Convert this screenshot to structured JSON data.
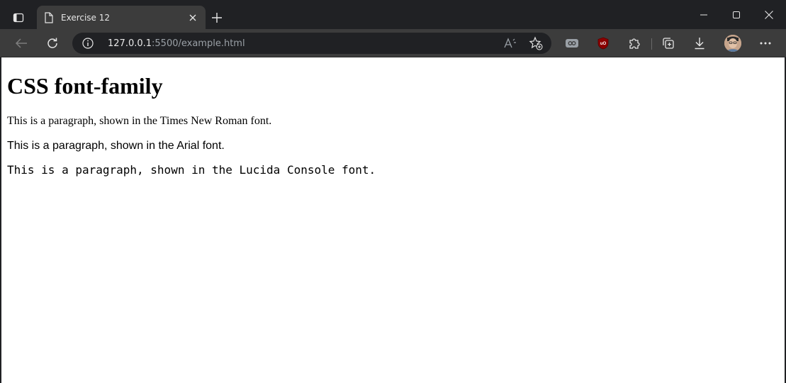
{
  "tab": {
    "title": "Exercise 12",
    "favicon": "document-icon"
  },
  "address_bar": {
    "url_host": "127.0.0.1",
    "url_rest": ":5500/example.html"
  },
  "page": {
    "heading": "CSS font-family",
    "paragraphs": [
      "This is a paragraph, shown in the Times New Roman font.",
      "This is a paragraph, shown in the Arial font.",
      "This is a paragraph, shown in the Lucida Console font."
    ]
  },
  "colors": {
    "tabstrip_bg": "#202124",
    "toolbar_bg": "#3c3c3c",
    "omnibox_bg": "#202124",
    "ublock_red": "#8b0000"
  }
}
